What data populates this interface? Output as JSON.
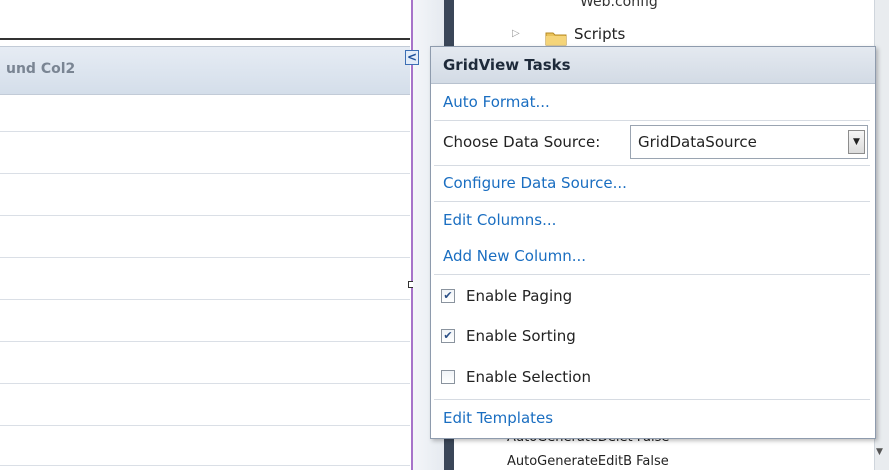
{
  "grid": {
    "header_label": "und Col2"
  },
  "smart_tag_glyph": "<",
  "explorer": {
    "cut_item": "Web.config",
    "scripts_label": "Scripts"
  },
  "properties": {
    "row1": "AutoGenerateDelet False",
    "row2": "AutoGenerateEditB False"
  },
  "tasks": {
    "title": "GridView Tasks",
    "auto_format": "Auto Format...",
    "choose_label": "Choose Data Source:",
    "data_source_value": "GridDataSource",
    "configure": "Configure Data Source...",
    "edit_columns": "Edit Columns...",
    "add_column": "Add New Column...",
    "checkboxes": [
      {
        "label": "Enable Paging",
        "checked": true
      },
      {
        "label": "Enable Sorting",
        "checked": true
      },
      {
        "label": "Enable Selection",
        "checked": false
      }
    ],
    "edit_templates": "Edit Templates"
  },
  "colors": {
    "link": "#1a6ec1",
    "design_edge": "#a774c9",
    "header_bg": "#d4deea"
  },
  "icons": {
    "dropdown": "chevron-down-icon",
    "folder": "folder-icon",
    "check": "checkmark-icon"
  }
}
